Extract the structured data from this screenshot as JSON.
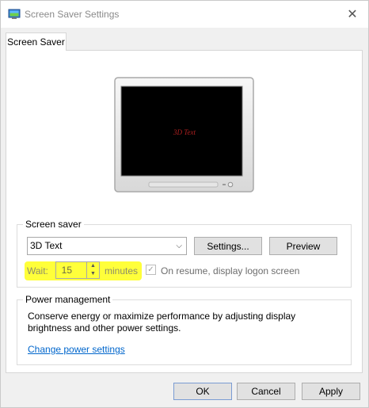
{
  "window": {
    "title": "Screen Saver Settings",
    "close_glyph": "✕",
    "icon": "screen-saver-app-icon"
  },
  "tabs": [
    {
      "label": "Screen Saver",
      "selected": true
    }
  ],
  "preview": {
    "screen_text": "3D Text"
  },
  "screen_saver_group": {
    "legend": "Screen saver",
    "selected_saver": "3D Text",
    "settings_label": "Settings...",
    "preview_label": "Preview",
    "wait_label": "Wait:",
    "wait_value": "15",
    "minutes_label": "minutes",
    "resume_checked": true,
    "resume_label": "On resume, display logon screen",
    "highlight_color": "#ffff3a"
  },
  "power_group": {
    "legend": "Power management",
    "description": "Conserve energy or maximize performance by adjusting display brightness and other power settings.",
    "link_label": "Change power settings"
  },
  "footer": {
    "ok_label": "OK",
    "cancel_label": "Cancel",
    "apply_label": "Apply"
  }
}
